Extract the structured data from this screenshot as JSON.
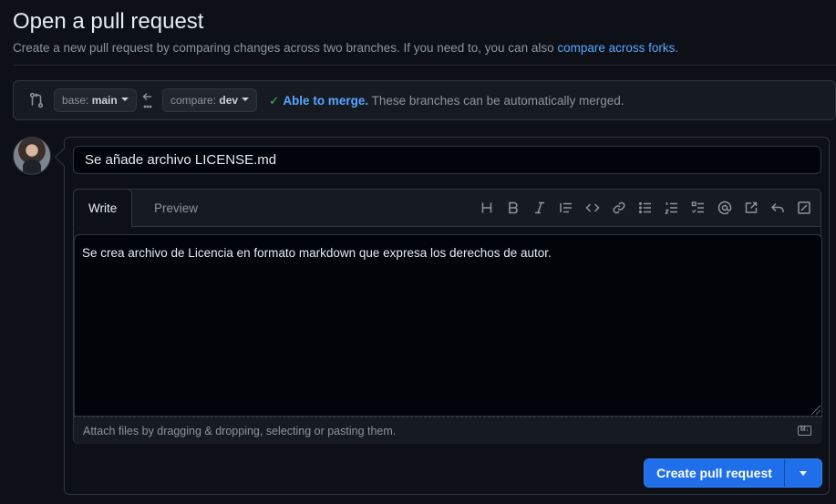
{
  "header": {
    "title": "Open a pull request",
    "subtitle_text": "Create a new pull request by comparing changes across two branches. If you need to, you can also ",
    "subtitle_link": "compare across forks",
    "subtitle_end": "."
  },
  "range": {
    "base_prefix": "base:",
    "base_branch": "main",
    "compare_prefix": "compare:",
    "compare_branch": "dev",
    "merge_status": "Able to merge.",
    "merge_detail": " These branches can be automatically merged."
  },
  "form": {
    "title_value": "Se añade archivo LICENSE.md",
    "tabs": [
      "Write",
      "Preview"
    ],
    "body_value": "Se crea archivo de Licencia en formato markdown que expresa los derechos de autor.",
    "attach_hint": "Attach files by dragging & dropping, selecting or pasting them.",
    "markdown_badge": "M↓",
    "submit_label": "Create pull request"
  },
  "toolbar_icons": [
    "heading-icon",
    "bold-icon",
    "italic-icon",
    "quote-icon",
    "code-icon",
    "link-icon",
    "unordered-list-icon",
    "ordered-list-icon",
    "task-list-icon",
    "mention-icon",
    "reference-icon",
    "reply-icon",
    "diff-icon"
  ],
  "colors": {
    "background": "#0d1117",
    "accent": "#58a6ff",
    "success": "#3fb950",
    "primary_button": "#1f6feb"
  }
}
